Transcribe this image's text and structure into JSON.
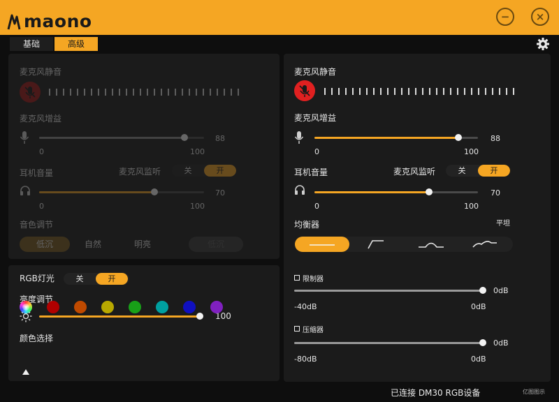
{
  "app": {
    "brand": "maono"
  },
  "tabs": [
    {
      "label": "基础",
      "active": false
    },
    {
      "label": "高级",
      "active": true
    }
  ],
  "left_mic": {
    "mute_label": "麦克风静音",
    "gain_label": "麦克风增益",
    "gain_value": "88",
    "gain_min": "0",
    "gain_max": "100",
    "gain_level": 0.88,
    "headphone_label": "耳机音量",
    "monitor_label": "麦克风监听",
    "monitor_off": "关",
    "monitor_on": "开",
    "headphone_value": "70",
    "headphone_min": "0",
    "headphone_max": "100",
    "headphone_level": 0.7,
    "tone_label": "音色调节",
    "tone_options": [
      "低沉",
      "自然",
      "明亮"
    ],
    "tone_selected": "低沉"
  },
  "rgb": {
    "label": "RGB灯光",
    "off": "关",
    "on": "开",
    "brightness_label": "亮度调节",
    "brightness_value": "100",
    "brightness_level": 1.0,
    "color_label": "颜色选择",
    "colors": [
      "#b00000",
      "#c04a00",
      "#b8a800",
      "#18a018",
      "#00a0a0",
      "#1010c0",
      "#8020c0"
    ]
  },
  "right_mic": {
    "mute_label": "麦克风静音",
    "gain_label": "麦克风增益",
    "gain_value": "88",
    "gain_min": "0",
    "gain_max": "100",
    "gain_level": 0.88,
    "headphone_label": "耳机音量",
    "monitor_label": "麦克风监听",
    "monitor_off": "关",
    "monitor_on": "开",
    "headphone_value": "70",
    "headphone_min": "0",
    "headphone_max": "100",
    "headphone_level": 0.7,
    "eq_label": "均衡器",
    "eq_selected_name": "平坦",
    "limiter_label": "限制器",
    "limiter_value": "0dB",
    "limiter_min": "-40dB",
    "limiter_max": "0dB",
    "limiter_level": 1.0,
    "compressor_label": "压缩器",
    "compressor_value": "0dB",
    "compressor_min": "-80dB",
    "compressor_max": "0dB",
    "compressor_level": 1.0
  },
  "status": {
    "connected_text": "已连接 DM30 RGB设备"
  },
  "watermark": "亿图图示",
  "colors": {
    "accent": "#f5a623",
    "mute_red": "#e02020",
    "panel": "#1b1b1b",
    "background": "#0e0e0e"
  }
}
